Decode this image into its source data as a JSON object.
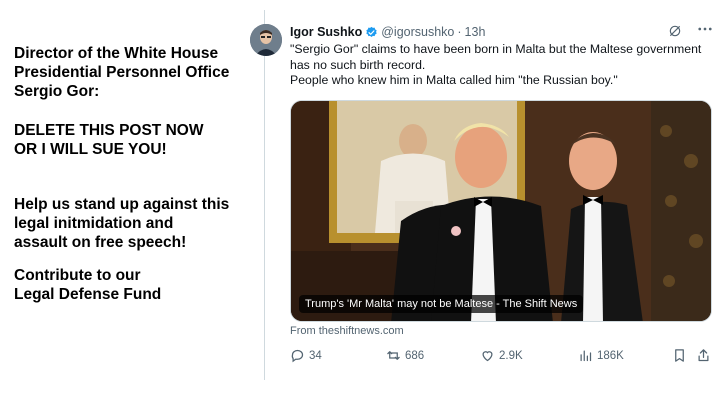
{
  "left_panel": {
    "heading": "Director of the White House\nPresidential Personnel Office\nSergio Gor:",
    "demand": "DELETE THIS POST NOW\nOR I WILL SUE YOU!",
    "appeal": "Help us stand up against this\nlegal initmidation and\nassault on free speech!",
    "cta": "Contribute to our\nLegal Defense Fund"
  },
  "tweet": {
    "author_name": "Igor Sushko",
    "handle": "@igorsushko",
    "separator": "·",
    "time": "13h",
    "text": "\"Sergio Gor\" claims to have been born in Malta but the Maltese government has no such birth record.\nPeople who knew him in Malta called him \"the Russian boy.\"",
    "card_caption": "Trump's 'Mr Malta' may not be Maltese - The Shift News",
    "card_source": "From theshiftnews.com",
    "stats": {
      "replies": "34",
      "reposts": "686",
      "likes": "2.9K",
      "views": "186K"
    }
  },
  "colors": {
    "verified": "#1d9bf0",
    "muted": "#536471",
    "text": "#0f1419"
  },
  "icons": [
    "verified-icon",
    "grok-icon",
    "more-icon",
    "reply-icon",
    "repost-icon",
    "like-icon",
    "views-icon",
    "bookmark-icon",
    "share-icon"
  ]
}
